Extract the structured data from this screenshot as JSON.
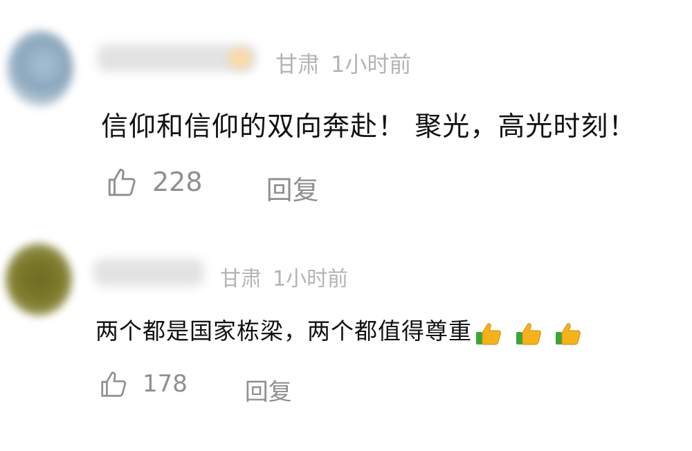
{
  "comments": [
    {
      "location": "甘肃",
      "time": "1小时前",
      "text": "信仰和信仰的双向奔赴！ 聚光，高光时刻！",
      "likes": "228",
      "reply_label": "回复",
      "emoji_count": 0
    },
    {
      "location": "甘肃",
      "time": "1小时前",
      "text": "两个都是国家栋梁，两个都值得尊重",
      "likes": "178",
      "reply_label": "回复",
      "emoji_count": 3
    }
  ],
  "icons": {
    "like": "thumbs-up-outline-icon",
    "emoji": "thumbs-up-emoji"
  },
  "colors": {
    "meta_gray": "#b4b4b4",
    "action_gray": "#8f8f8f",
    "text": "#111111",
    "emoji_yellow": "#f6b21a",
    "emoji_green": "#3aa63a"
  }
}
